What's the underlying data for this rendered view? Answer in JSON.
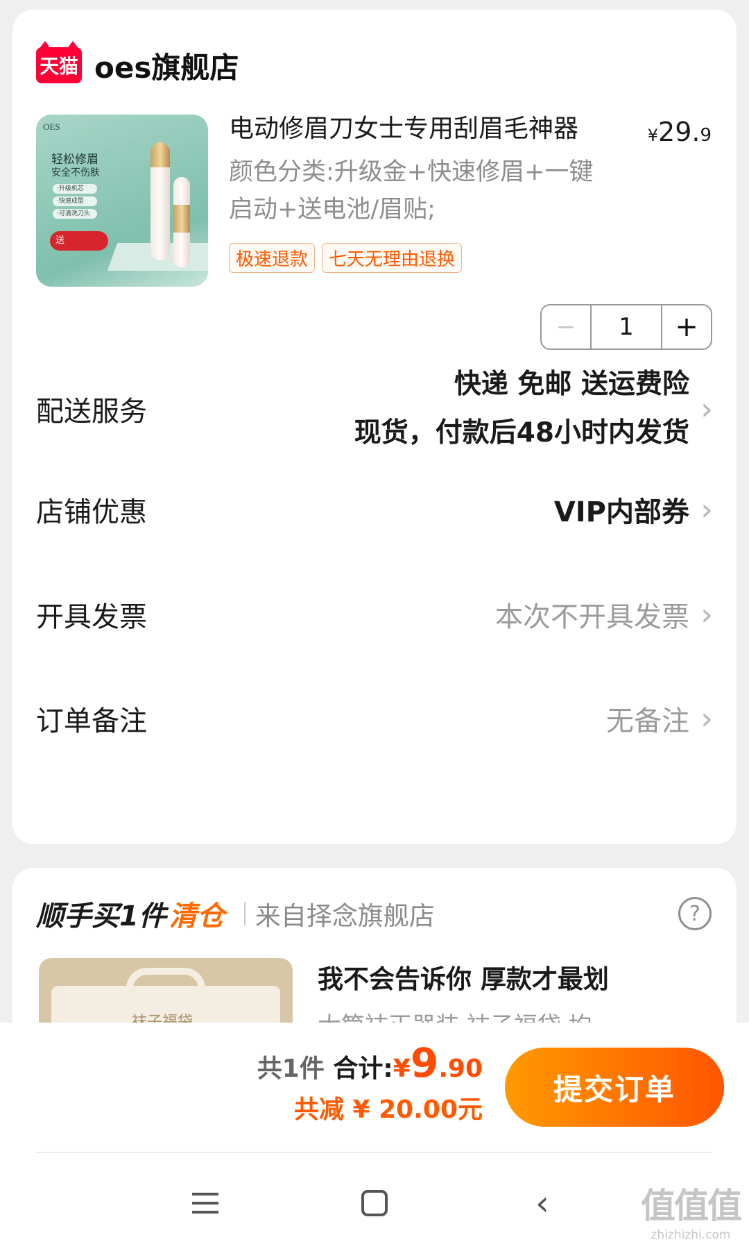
{
  "shop": {
    "logo_text": "天猫",
    "name": "oes旗舰店"
  },
  "product": {
    "image_text": {
      "brand": "OES",
      "headline_1": "轻松修眉",
      "headline_2": "安全不伤肤",
      "feature_1": "·升级机芯",
      "feature_2": "·快速成型",
      "feature_3": "·可清洗刀头",
      "gift": "送"
    },
    "title": "电动修眉刀女士专用刮眉毛神器",
    "price_currency": "¥",
    "price_int": "29.",
    "price_dec": "9",
    "spec": "颜色分类:升级金+快速修眉+一键启动+送电池/眉贴;",
    "tags": [
      "极速退款",
      "七天无理由退换"
    ],
    "quantity": {
      "minus": "−",
      "value": "1",
      "plus": "+"
    }
  },
  "rows": {
    "delivery": {
      "label": "配送服务",
      "line1": "快递 免邮 送运费险",
      "line2": "现货，付款后48小时内发货"
    },
    "coupon": {
      "label": "店铺优惠",
      "value": "VIP内部券"
    },
    "invoice": {
      "label": "开具发票",
      "value": "本次不开具发票"
    },
    "note": {
      "label": "订单备注",
      "value": "无备注"
    },
    "chevron": "›"
  },
  "addon": {
    "title": "顺手买1件",
    "tag": "清仓",
    "from": "来自择念旗舰店",
    "help": "?",
    "image_label": "袜子福袋",
    "name": "我不会告诉你 厚款才最划",
    "sub": "大筒袜正器装 袜子福袋 均"
  },
  "footer": {
    "count": "共1件",
    "total_label": " 合计:",
    "total_currency": "¥",
    "total_big": "9",
    "total_small": ".90",
    "discount": "共减 ¥ 20.00元",
    "submit": "提交订单"
  },
  "nav": {
    "back": "‹"
  },
  "watermark": {
    "main": "值值值",
    "site": "zhizhizhi.com"
  },
  "colors": {
    "accent": "#ff5500",
    "tmall_red": "#ff0036",
    "background": "#efefef"
  }
}
